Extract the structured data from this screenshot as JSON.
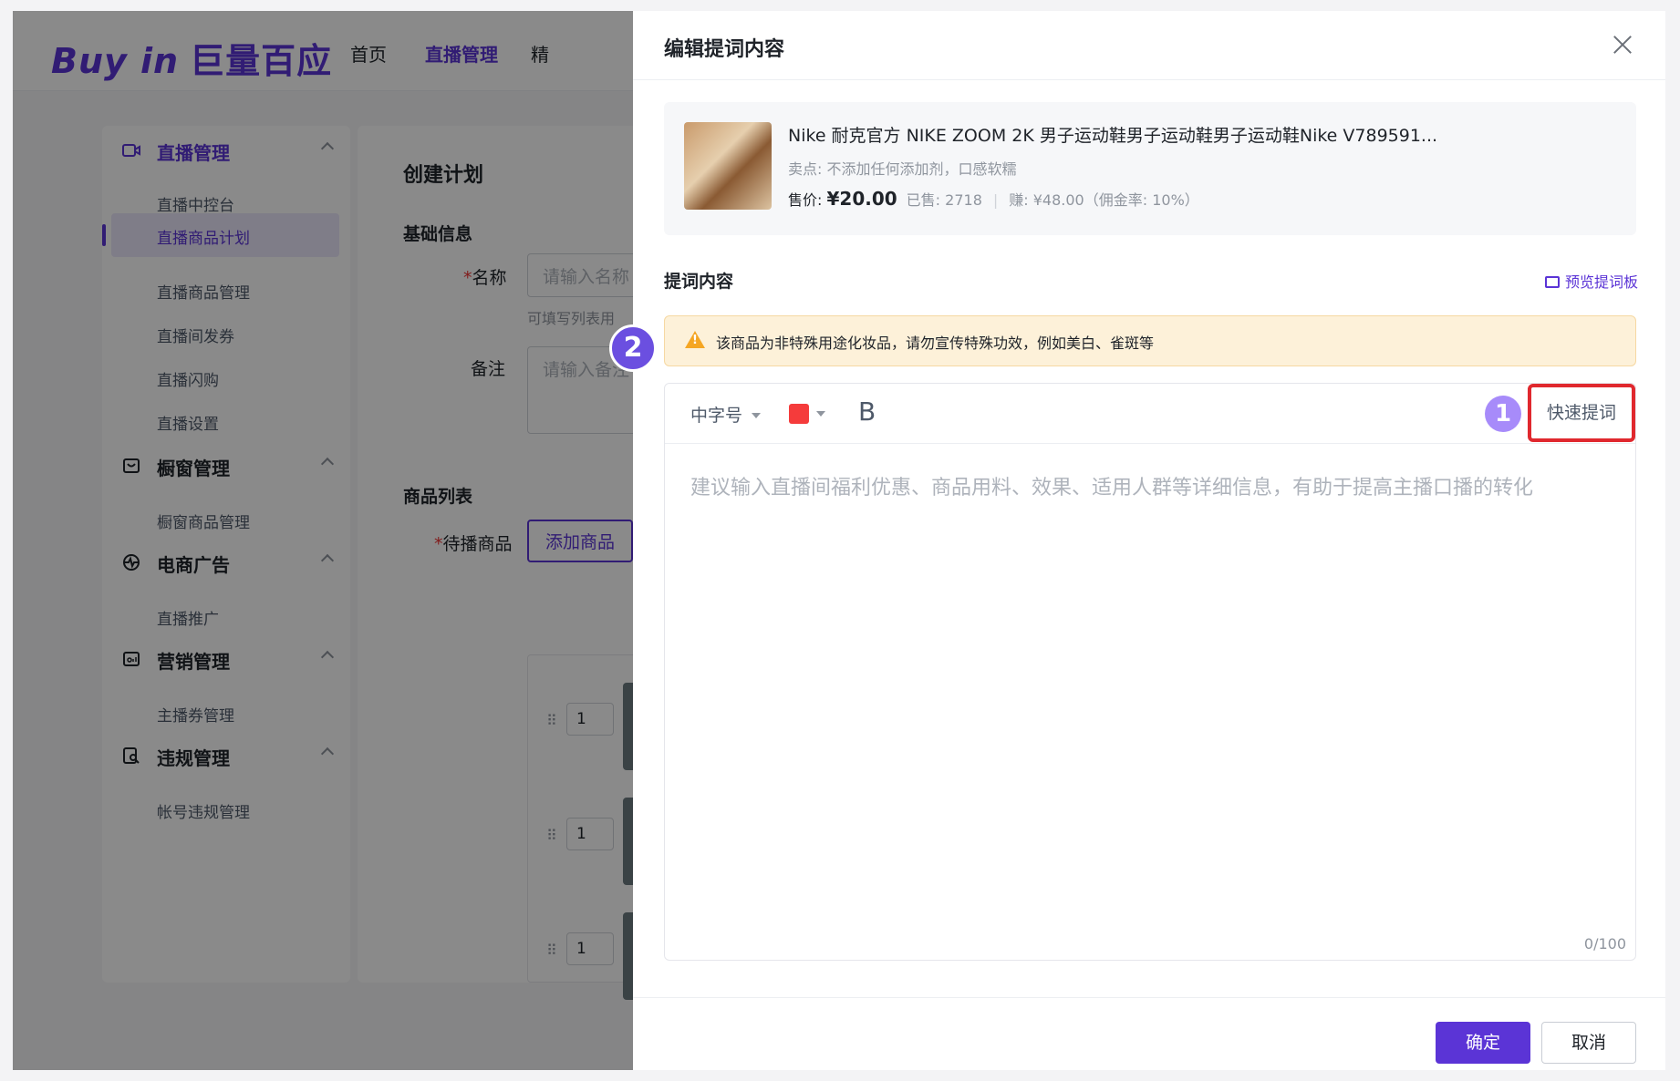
{
  "brand": {
    "logo_en": "Buy in",
    "logo_cn": "巨量百应"
  },
  "topnav": {
    "home": "首页",
    "live": "直播管理",
    "more": "精"
  },
  "sidebar": {
    "live": {
      "title": "直播管理",
      "items": [
        "直播中控台",
        "直播商品计划",
        "直播商品管理",
        "直播间发券",
        "直播闪购",
        "直播设置"
      ]
    },
    "window": {
      "title": "橱窗管理",
      "items": [
        "橱窗商品管理"
      ]
    },
    "ads": {
      "title": "电商广告",
      "items": [
        "直播推广"
      ]
    },
    "marketing": {
      "title": "营销管理",
      "items": [
        "主播券管理"
      ]
    },
    "violation": {
      "title": "违规管理",
      "items": [
        "帐号违规管理"
      ]
    }
  },
  "main": {
    "title": "创建计划",
    "basic": "基础信息",
    "name_label": "名称",
    "name_placeholder": "请输入名称",
    "name_hint": "可填写列表用",
    "note_label": "备注",
    "note_placeholder": "请输入备注",
    "list_title": "商品列表",
    "pending_label": "待播商品",
    "add_button": "添加商品",
    "rows": [
      "1",
      "1",
      "1"
    ]
  },
  "drawer": {
    "title": "编辑提词内容",
    "product": {
      "name": "Nike 耐克官方 NIKE ZOOM 2K 男子运动鞋男子运动鞋男子运动鞋Nike V789591...",
      "selling_point": "卖点: 不添加任何添加剂，口感软糯",
      "price_label": "售价: ",
      "price": "¥20.00",
      "sold": "已售: 2718",
      "earn": "赚: ¥48.00（佣金率: 10%）"
    },
    "section_title": "提词内容",
    "preview_link": "预览提词板",
    "warning": "该商品为非特殊用途化妆品，请勿宣传特殊功效，例如美白、雀斑等",
    "toolbar": {
      "font_size": "中字号",
      "bold": "B",
      "quick": "快速提词"
    },
    "placeholder": "建议输入直播间福利优惠、商品用料、效果、适用人群等详细信息，有助于提高主播口播的转化",
    "counter": "0/100",
    "confirm": "确定",
    "cancel": "取消"
  },
  "annotations": {
    "badge1": "1",
    "badge2": "2"
  },
  "colors": {
    "accent": "#5b34d6",
    "warning_bg": "#fdf1d9",
    "highlight": "#e0282e",
    "text_color_swatch": "#f53b3b"
  }
}
